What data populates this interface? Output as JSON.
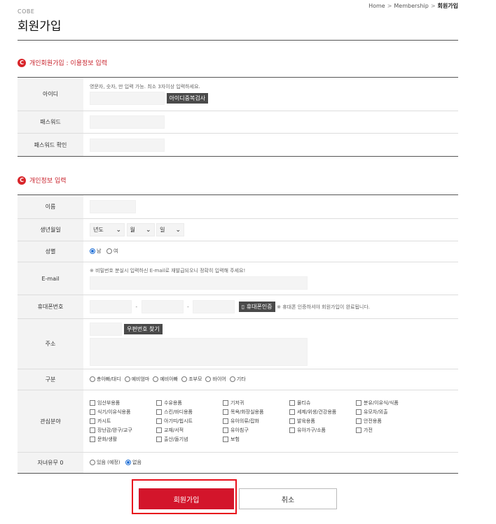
{
  "breadcrumb": {
    "home": "Home",
    "sep": ">",
    "section": "Membership",
    "current": "회원가입"
  },
  "brand": "COBE",
  "page_title": "회원가입",
  "section1": {
    "badge": "C",
    "title": "개인회원가입 : 이용정보 입력",
    "rows": {
      "id_label": "아이디",
      "id_hint": "영문자, 숫자,    만 입력 가능. 최소 3자이상 입력하세요.",
      "id_check_button": "아이디중복검사",
      "pw_label": "패스워드",
      "pw_confirm_label": "패스워드 확인"
    }
  },
  "section2": {
    "badge": "C",
    "title": "개인정보 입력",
    "rows": {
      "name_label": "이름",
      "birth_label": "생년월일",
      "birth_year": "년도",
      "birth_month": "월",
      "birth_day": "일",
      "gender_label": "성별",
      "gender_male": "남",
      "gender_female": "여",
      "email_label": "E-mail",
      "email_hint": "※ 비밀번호 분실시 입력하신 E-mail로 재발급되오니 정확히 입력해 주세요!",
      "phone_label": "휴대폰번호",
      "phone_dash": "-",
      "phone_verify_button": "휴대폰인증",
      "phone_hint": "※ 휴대폰 인증하셔야 회원가입이 완료됩니다.",
      "address_label": "주소",
      "zip_button": "우편번호 찾기",
      "type_label": "구분",
      "type_options": [
        "총아빠/대디",
        "예비엄마",
        "예비아빠",
        "조부모",
        "바이어",
        "기타"
      ],
      "interest_label": "관심분야",
      "interests": [
        "임산부용품",
        "수유용품",
        "기저귀",
        "물티슈",
        "분유/이유식/식품",
        "식기/이유식용품",
        "스킨/바디용품",
        "목욕/화장실용품",
        "세제/위생/건강용품",
        "유모차/외출",
        "카시트",
        "아기띠/힙시트",
        "유아의류/잡화",
        "발육용품",
        "안전용품",
        "장난감/완구/교구",
        "교재/서적",
        "유아침구",
        "유아가구/소품",
        "가전",
        "문화/생활",
        "출산/돌기념",
        "보험"
      ],
      "children_label": "자녀유무 0",
      "children_yes": "있음 (예정)",
      "children_no": "없음"
    }
  },
  "buttons": {
    "submit": "회원가입",
    "cancel": "취소"
  },
  "colors": {
    "accent": "#d3152b",
    "radio_selected": "#1f6fd6"
  }
}
